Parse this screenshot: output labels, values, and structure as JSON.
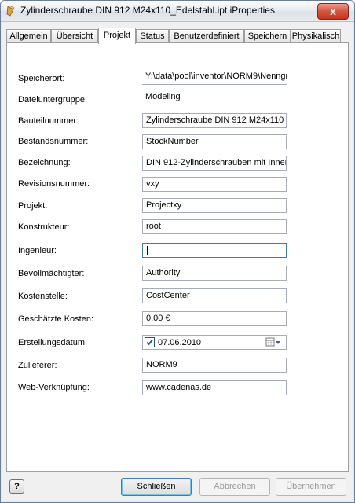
{
  "window": {
    "title": "Zylinderschraube DIN 912 M24x110_Edelstahl.ipt iProperties",
    "close_label": "x"
  },
  "tabs": [
    {
      "label": "Allgemein"
    },
    {
      "label": "Übersicht"
    },
    {
      "label": "Projekt",
      "active": true
    },
    {
      "label": "Status"
    },
    {
      "label": "Benutzerdefiniert"
    },
    {
      "label": "Speichern"
    },
    {
      "label": "Physikalisch"
    }
  ],
  "fields": {
    "speicherort": {
      "label": "Speicherort:",
      "value": "Y:\\data\\pool\\inventor\\NORM9\\Nenngr"
    },
    "dateiuntergruppe": {
      "label": "Dateiuntergruppe:",
      "value": "Modeling"
    },
    "bauteilnummer": {
      "label": "Bauteilnummer:",
      "value": "Zylinderschraube DIN 912 M24x110"
    },
    "bestandsnummer": {
      "label": "Bestandsnummer:",
      "value": "StockNumber"
    },
    "bezeichnung": {
      "label": "Bezeichnung:",
      "value": "DIN 912-Zylinderschrauben mit Inner"
    },
    "revisionsnummer": {
      "label": "Revisionsnummer:",
      "value": "vxy"
    },
    "projekt": {
      "label": "Projekt:",
      "value": "Projectxy"
    },
    "konstrukteur": {
      "label": "Konstrukteur:",
      "value": "root"
    },
    "ingenieur": {
      "label": "Ingenieur:",
      "value": ""
    },
    "bevollmaechtigter": {
      "label": "Bevollmächtigter:",
      "value": "Authority"
    },
    "kostenstelle": {
      "label": "Kostenstelle:",
      "value": "CostCenter"
    },
    "geschaetzte_kosten": {
      "label": "Geschätzte Kosten:",
      "value": "0,00 €"
    },
    "erstellungsdatum": {
      "label": "Erstellungsdatum:",
      "value": "07.06.2010",
      "checked": true
    },
    "zulieferer": {
      "label": "Zulieferer:",
      "value": "NORM9"
    },
    "web_verknuepfung": {
      "label": "Web-Verknüpfung:",
      "value": "www.cadenas.de"
    }
  },
  "buttons": {
    "help": "?",
    "close": "Schließen",
    "cancel": "Abbrechen",
    "apply": "Übernehmen"
  },
  "icons": {
    "app": "inventor-part-icon",
    "calendar": "calendar-dropdown-icon"
  }
}
